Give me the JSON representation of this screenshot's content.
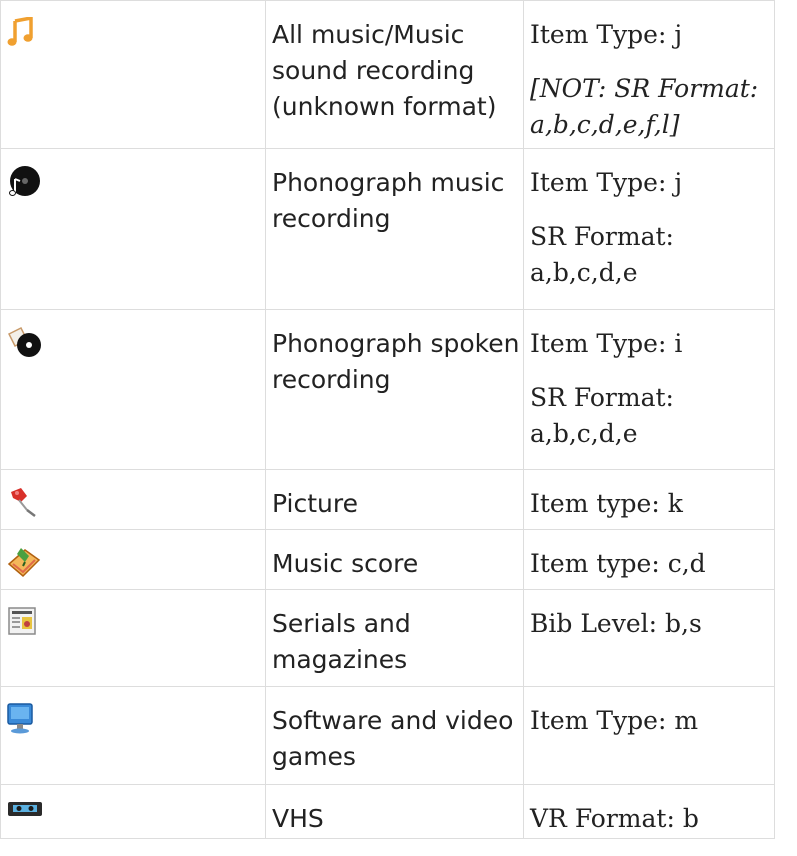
{
  "rows": [
    {
      "icon": "music-note-icon",
      "label": "All music/Music sound recording (unknown format)",
      "rules": [
        "Item Type: j"
      ],
      "rules_em": "[NOT: SR Format: a,b,c,d,e,f,l]"
    },
    {
      "icon": "phonograph-music-icon",
      "label": "Phonograph music recording",
      "rules": [
        "Item Type: j",
        "SR Format: a,b,c,d,e"
      ]
    },
    {
      "icon": "phonograph-spoken-icon",
      "label": "Phonograph spoken recording",
      "rules": [
        "Item Type: i",
        "SR Format: a,b,c,d,e"
      ]
    },
    {
      "icon": "pushpin-icon",
      "label": "Picture",
      "rules": [
        "Item type: k"
      ]
    },
    {
      "icon": "music-score-icon",
      "label": "Music score",
      "rules": [
        "Item type: c,d"
      ]
    },
    {
      "icon": "newspaper-icon",
      "label": "Serials and magazines",
      "rules": [
        "Bib Level: b,s"
      ]
    },
    {
      "icon": "monitor-icon",
      "label": "Software and video games",
      "rules": [
        "Item Type: m"
      ]
    },
    {
      "icon": "vhs-tape-icon",
      "label": "VHS",
      "rules": [
        "VR Format: b"
      ]
    }
  ],
  "colors": {
    "border": "#dddddd",
    "text": "#222222",
    "note_orange": "#f0a030"
  }
}
